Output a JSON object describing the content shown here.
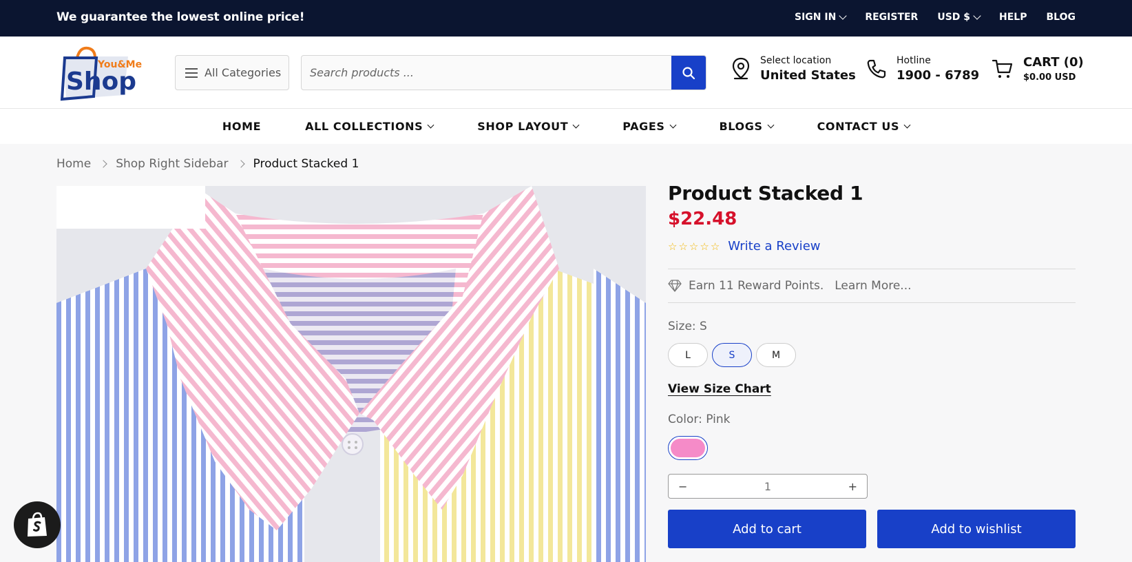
{
  "topbar": {
    "promo": "We guarantee the lowest online price!",
    "links": [
      "SIGN IN",
      "REGISTER",
      "USD $",
      "HELP",
      "BLOG"
    ]
  },
  "header": {
    "logo": {
      "top": "You&Me",
      "main": "Shop"
    },
    "categories_label": "All Categories",
    "search_placeholder": "Search products ...",
    "location": {
      "small": "Select location",
      "big": "United States"
    },
    "hotline": {
      "small": "Hotline",
      "big": "1900 - 6789"
    },
    "cart": {
      "label": "CART (0)",
      "total": "$0.00 USD"
    }
  },
  "nav": [
    "HOME",
    "ALL COLLECTIONS",
    "SHOP LAYOUT",
    "PAGES",
    "BLOGS",
    "CONTACT US"
  ],
  "breadcrumb": [
    "Home",
    "Shop Right Sidebar",
    "Product Stacked 1"
  ],
  "product": {
    "title": "Product Stacked 1",
    "price": "$22.48",
    "rating": 0,
    "review_link": "Write a Review",
    "reward_text": "Earn 11 Reward Points.",
    "reward_link": "Learn More...",
    "size_label": "Size: S",
    "sizes": [
      "L",
      "S",
      "M"
    ],
    "selected_size": "S",
    "size_chart": "View Size Chart",
    "color_label": "Color: Pink",
    "color_swatch": "#f58bc8",
    "quantity": "1",
    "add_to_cart": "Add to cart",
    "add_to_wishlist": "Add to wishlist"
  },
  "colors": {
    "accent": "#1840c8",
    "topbar": "#0b1530",
    "price": "#d6112b"
  }
}
